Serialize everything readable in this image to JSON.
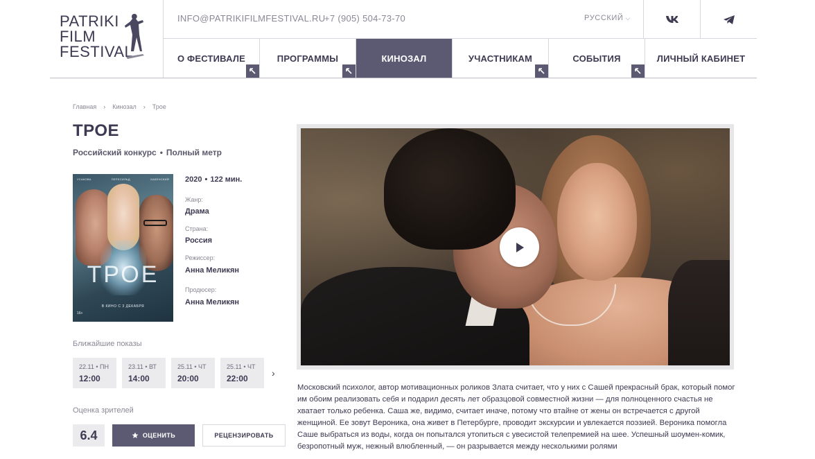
{
  "logo": {
    "line1": "PATRIKI",
    "line2": "FILM",
    "line3": "FESTIVAL"
  },
  "header": {
    "email": "INFO@PATRIKIFILMFESTIVAL.RU",
    "phone": "+7 (905) 504-73-70",
    "language": "РУССКИЙ",
    "social": [
      "vk-icon",
      "telegram-icon"
    ]
  },
  "nav": {
    "items": [
      {
        "label": "О ФЕСТИВАЛЕ"
      },
      {
        "label": "ПРОГРАММЫ"
      },
      {
        "label": "КИНОЗАЛ",
        "active": true
      },
      {
        "label": "УЧАСТНИКАМ"
      },
      {
        "label": "СОБЫТИЯ"
      },
      {
        "label": "ЛИЧНЫЙ КАБИНЕТ"
      }
    ]
  },
  "breadcrumb": [
    "Главная",
    "Кинозал",
    "Трое"
  ],
  "film": {
    "title": "ТРОЕ",
    "competition": "Российский конкурс",
    "format": "Полный метр",
    "year": "2020",
    "duration": "122 мин.",
    "genre_label": "Жанр:",
    "genre": "Драма",
    "country_label": "Страна:",
    "country": "Россия",
    "director_label": "Режиссер:",
    "director": "Анна Меликян",
    "producer_label": "Продюсер:",
    "producer": "Анна Меликян"
  },
  "poster": {
    "names": [
      "УСАКОВА",
      "ПЕРЕСИЛЬД",
      "ХАБЕНСКИЙ"
    ],
    "title": "ТРОЕ",
    "release": "В КИНО С 3 ДЕКАБРЯ",
    "age": "16+"
  },
  "screenings": {
    "title": "Ближайшие показы",
    "items": [
      {
        "date": "22.11 • ПН",
        "time": "12:00"
      },
      {
        "date": "23.11 • ВТ",
        "time": "14:00"
      },
      {
        "date": "25.11 • ЧТ",
        "time": "20:00"
      },
      {
        "date": "25.11 • ЧТ",
        "time": "22:00"
      }
    ]
  },
  "rating": {
    "title": "Оценка зрителей",
    "value": "6.4",
    "rate_label": "ОЦЕНИТЬ",
    "review_label": "РЕЦЕНЗИРОВАТЬ"
  },
  "description": "Московский психолог, автор мотивационных роликов Злата считает, что у них с Сашей прекрасный брак, который помог им обоим реализовать себя и подарил десять лет образцовой совместной жизни — для полноценного счастья не хватает только ребенка. Саша же, видимо, считает иначе, потому что втайне от жены он встречается с другой женщиной. Ее зовут Вероника, она живет в Петербурге, проводит экскурсии и увлекается поэзией. Вероника помогла Саше выбраться из воды, когда он попытался утопиться с увесистой телепремией на шее. Успешный шоумен-комик, безропотный муж, нежный влюбленный, — он разрывается между несколькими ролями",
  "colors": {
    "accent": "#5c5a73",
    "text": "#3d3a52",
    "muted": "#8a8896",
    "tile": "#ebebee"
  }
}
